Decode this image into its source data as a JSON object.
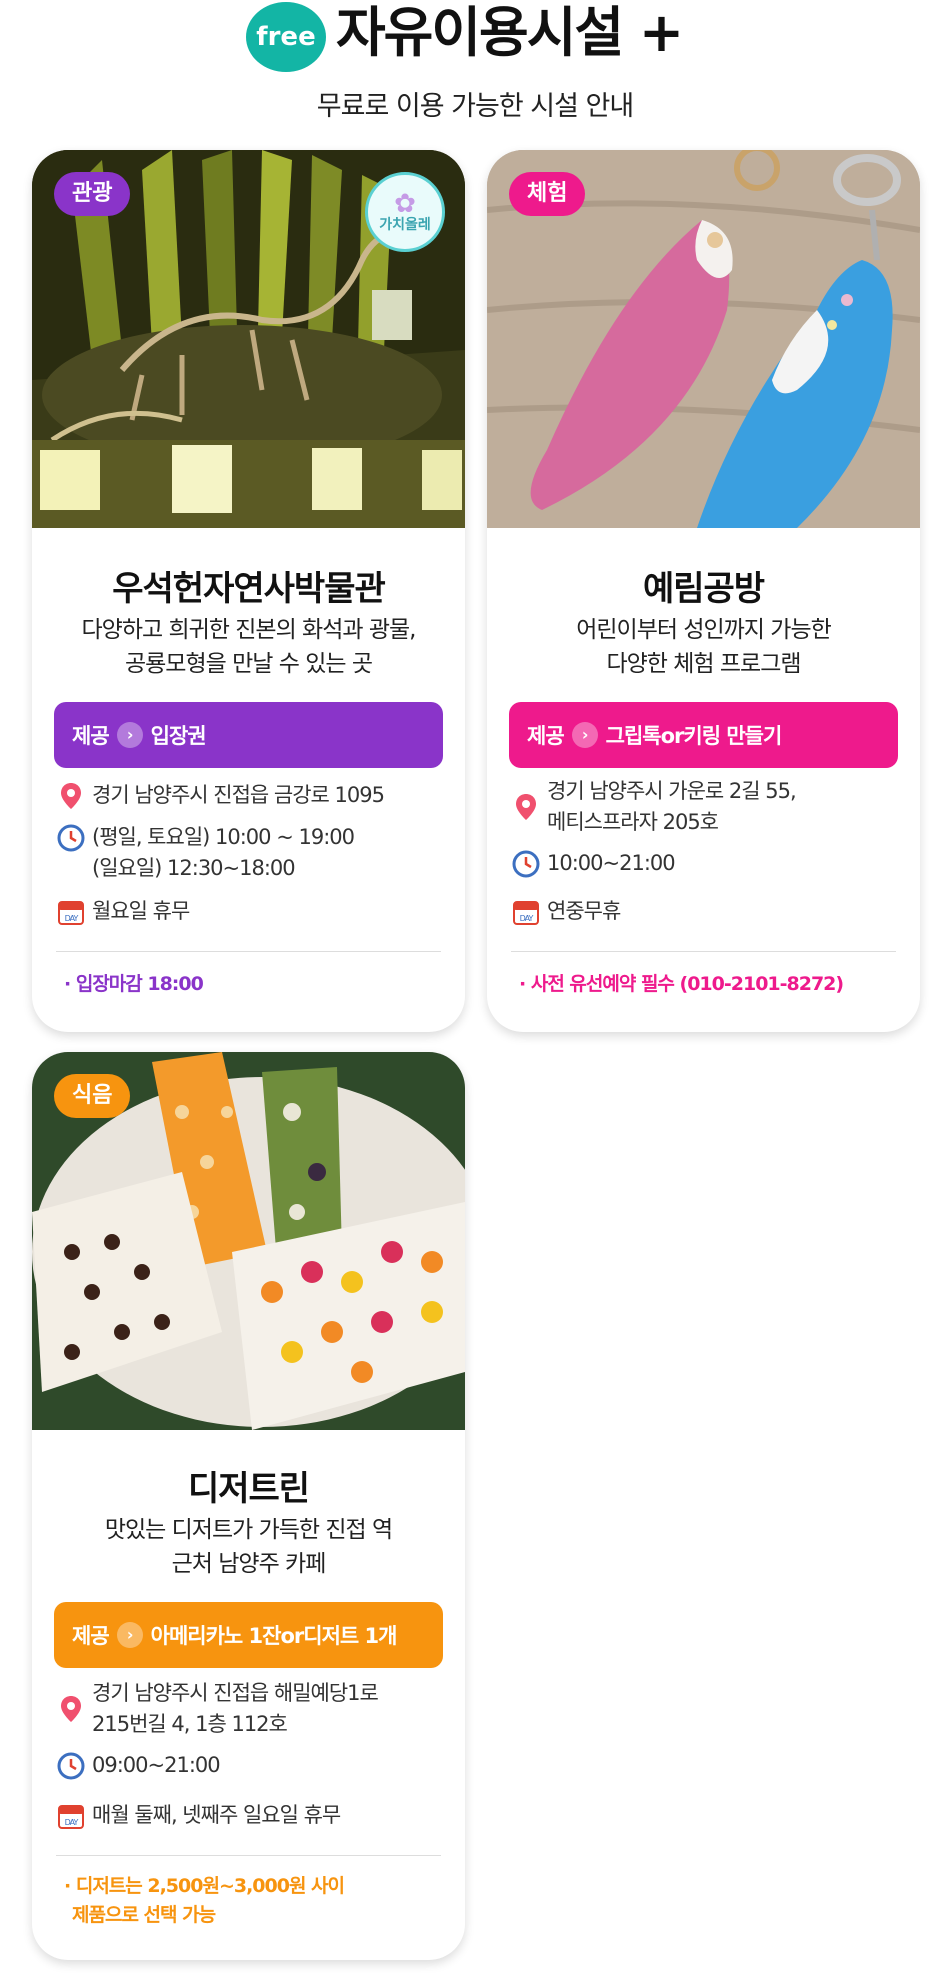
{
  "header": {
    "badge": "free",
    "title": "자유이용시설 +",
    "subtitle": "무료로 이용 가능한 시설 안내"
  },
  "colors": {
    "teal": "#13b5a5",
    "purple": "#8a34c9",
    "pink": "#ee1a8c",
    "orange": "#f7940f"
  },
  "cards": [
    {
      "category": "관광",
      "stamp": "가치올레",
      "name": "우석헌자연사박물관",
      "desc": [
        "다양하고 희귀한 진본의 화석과 광물,",
        "공룡모형을 만날 수 있는 곳"
      ],
      "offer_prefix": "제공",
      "offer": "입장권",
      "address": [
        "경기 남양주시 진접읍 금강로 1095"
      ],
      "hours": [
        "(평일, 토요일) 10:00 ~ 19:00",
        "(일요일) 12:30~18:00"
      ],
      "closed": "월요일 휴무",
      "note": [
        "· 입장마감 18:00"
      ]
    },
    {
      "category": "체험",
      "name": "예림공방",
      "desc": [
        "어린이부터 성인까지 가능한",
        "다양한 체험 프로그램"
      ],
      "offer_prefix": "제공",
      "offer": "그립톡or키링 만들기",
      "address": [
        "경기 남양주시 가운로 2길 55,",
        "메티스프라자 205호"
      ],
      "hours": [
        "10:00~21:00"
      ],
      "closed": "연중무휴",
      "note": [
        "· 사전 유선예약 필수 (010-2101-8272)"
      ]
    },
    {
      "category": "식음",
      "name": "디저트린",
      "desc": [
        "맛있는 디저트가 가득한 진접 역",
        "근처 남양주 카페"
      ],
      "offer_prefix": "제공",
      "offer": "아메리카노 1잔or디저트 1개",
      "address": [
        "경기 남양주시 진접읍 해밀예당1로",
        "215번길 4, 1층 112호"
      ],
      "hours": [
        "09:00~21:00"
      ],
      "closed": "매월 둘째, 넷째주 일요일 휴무",
      "note": [
        "· 디저트는 2,500원~3,000원 사이",
        "제품으로 선택 가능"
      ]
    }
  ],
  "icons": [
    "location-pin-icon",
    "clock-icon",
    "calendar-day-icon",
    "chevron-right-icon",
    "flower-icon"
  ]
}
